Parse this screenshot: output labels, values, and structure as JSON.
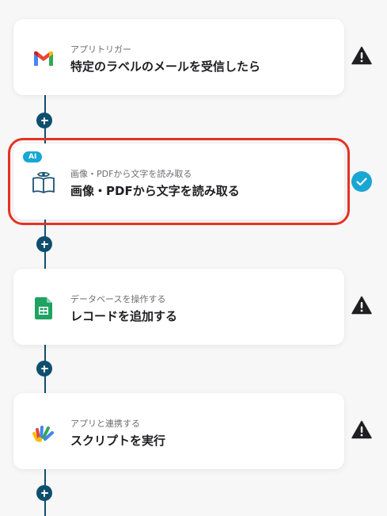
{
  "steps": [
    {
      "id": "gmail",
      "category": "アプリトリガー",
      "title": "特定のラベルのメールを受信したら",
      "icon": "gmail-icon",
      "status": "warning"
    },
    {
      "id": "ocr",
      "badge": "AI",
      "category": "画像・PDFから文字を読み取る",
      "title": "画像・PDFから文字を読み取る",
      "icon": "book-eye-icon",
      "status": "complete"
    },
    {
      "id": "sheets",
      "category": "データベースを操作する",
      "title": "レコードを追加する",
      "icon": "google-sheets-icon",
      "status": "warning"
    },
    {
      "id": "gas",
      "category": "アプリと連携する",
      "title": "スクリプトを実行",
      "icon": "google-apps-script-icon",
      "status": "warning"
    }
  ],
  "colors": {
    "connector": "#0f4f6e",
    "selected_outline": "#e53222",
    "ai_badge": "#18a6d4",
    "complete": "#18a6d4",
    "warning": "#1f1f22"
  }
}
